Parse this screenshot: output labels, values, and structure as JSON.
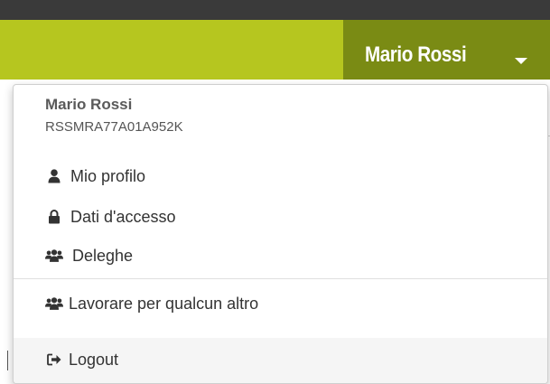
{
  "header": {
    "user_name": "Mario Rossi",
    "colors": {
      "top_bar": "#3a3a3a",
      "bar": "#b6c61f",
      "user_tab": "#7a8b14"
    }
  },
  "dropdown": {
    "name": "Mario Rossi",
    "fiscal_code": "RSSMRA77A01A952K",
    "items": [
      {
        "label": "Mio profilo",
        "icon": "user-icon"
      },
      {
        "label": "Dati d'accesso",
        "icon": "lock-icon"
      },
      {
        "label": "Deleghe",
        "icon": "users-icon"
      }
    ],
    "work_for_other": {
      "label": "Lavorare per qualcun altro",
      "icon": "users-icon"
    },
    "logout": {
      "label": "Logout",
      "icon": "sign-out-icon"
    }
  }
}
